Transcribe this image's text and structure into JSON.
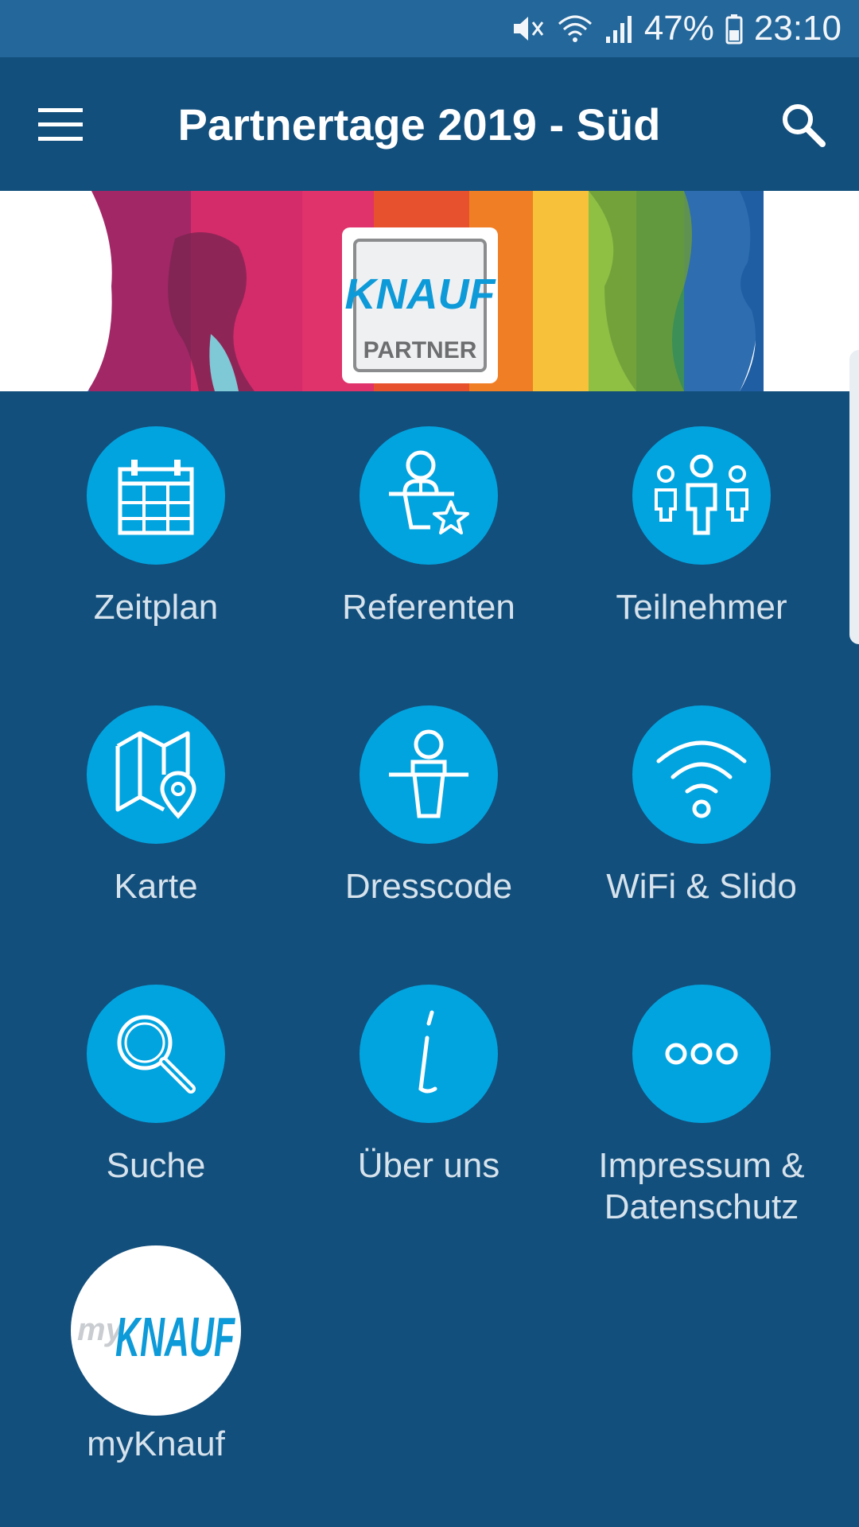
{
  "status_bar": {
    "battery": "47%",
    "time": "23:10",
    "icons": [
      "mute-icon",
      "wifi-icon",
      "signal-icon",
      "battery-icon"
    ]
  },
  "app_bar": {
    "title": "Partnertage 2019 - Süd",
    "menu_icon": "hamburger-menu-icon",
    "search_icon": "search-icon"
  },
  "banner": {
    "logo_text": "KNAUF",
    "logo_subtext": "PARTNER"
  },
  "tiles": [
    {
      "label": "Zeitplan",
      "icon": "calendar-icon"
    },
    {
      "label": "Referenten",
      "icon": "speaker-star-icon"
    },
    {
      "label": "Teilnehmer",
      "icon": "people-group-icon"
    },
    {
      "label": "Karte",
      "icon": "map-pin-icon"
    },
    {
      "label": "Dresscode",
      "icon": "person-desk-icon"
    },
    {
      "label": "WiFi & Slido",
      "icon": "wifi-icon"
    },
    {
      "label": "Suche",
      "icon": "magnifier-icon"
    },
    {
      "label": "Über uns",
      "icon": "info-icon"
    },
    {
      "label": "Impressum & Datenschutz",
      "icon": "more-dots-icon"
    },
    {
      "label": "myKnauf",
      "icon": "myknauf-logo-icon",
      "logo_my": "my",
      "logo_brand": "KNAUF"
    }
  ],
  "colors": {
    "background": "#124f7c",
    "status_bar": "#24679a",
    "tile_circle": "#02a4e0",
    "label_text": "#d6e2ec"
  }
}
